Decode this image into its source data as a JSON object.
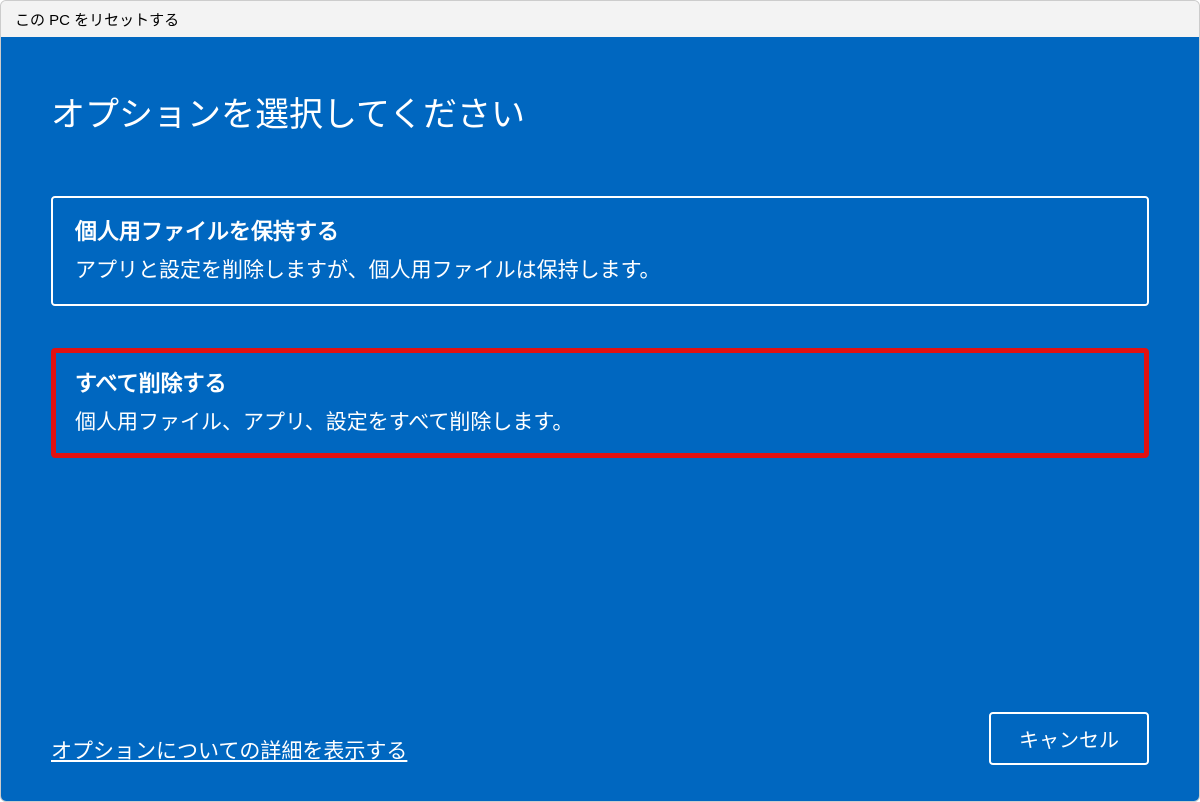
{
  "window": {
    "title": "この PC をリセットする"
  },
  "heading": "オプションを選択してください",
  "options": [
    {
      "title": "個人用ファイルを保持する",
      "description": "アプリと設定を削除しますが、個人用ファイルは保持します。"
    },
    {
      "title": "すべて削除する",
      "description": "個人用ファイル、アプリ、設定をすべて削除します。"
    }
  ],
  "footer": {
    "more_link": "オプションについての詳細を表示する",
    "cancel_label": "キャンセル"
  }
}
